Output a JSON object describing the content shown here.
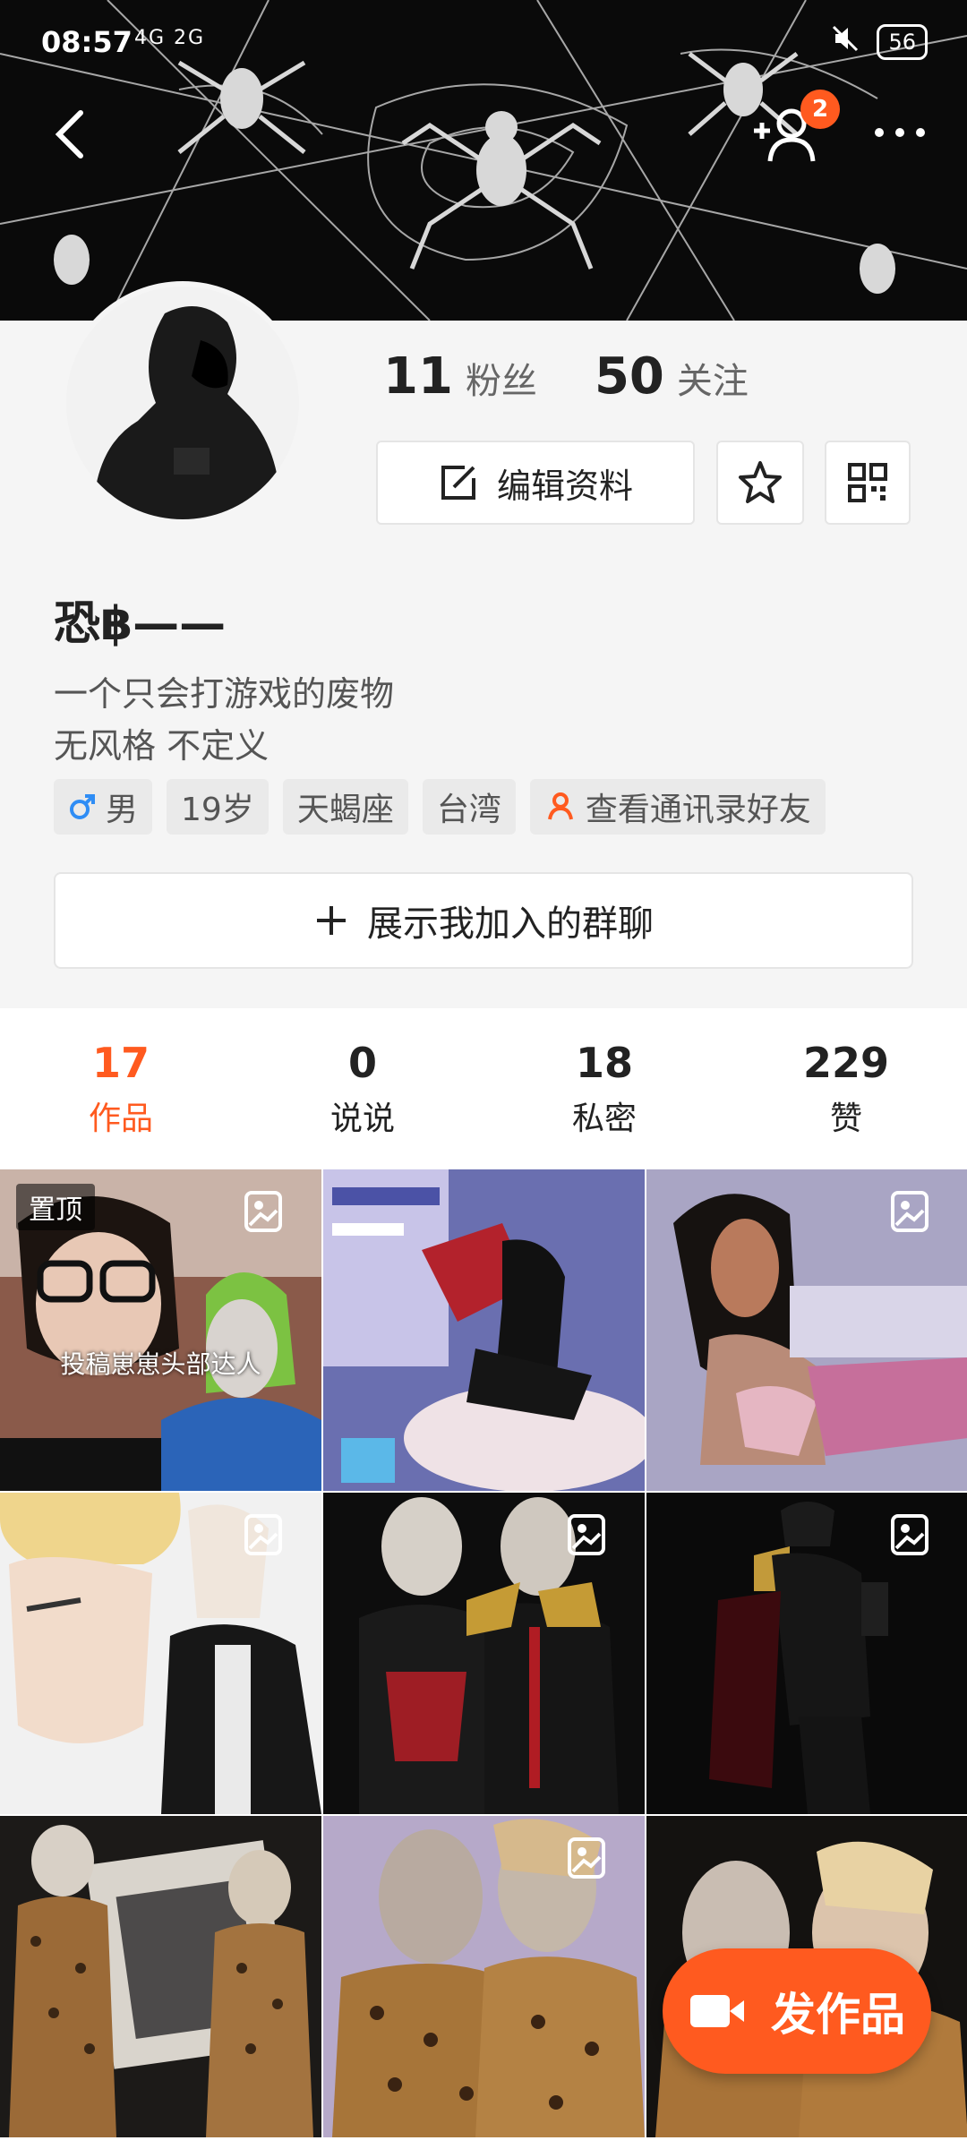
{
  "status_bar": {
    "time": "08:57",
    "network": "4G 2G",
    "battery": "56"
  },
  "header": {
    "notification_count": "2"
  },
  "profile": {
    "fans_count": "11",
    "fans_label": "粉丝",
    "following_count": "50",
    "following_label": "关注",
    "edit_label": "编辑资料",
    "username": "恐฿——",
    "bio_line1": "一个只会打游戏的废物",
    "bio_line2": "无风格 不定义",
    "tags": {
      "gender": "男",
      "age": "19岁",
      "zodiac": "天蝎座",
      "location": "台湾",
      "contacts": "查看通讯录好友"
    },
    "group_chat_label": "展示我加入的群聊"
  },
  "tabs": [
    {
      "count": "17",
      "label": "作品"
    },
    {
      "count": "0",
      "label": "说说"
    },
    {
      "count": "18",
      "label": "私密"
    },
    {
      "count": "229",
      "label": "赞"
    }
  ],
  "grid": {
    "pinned_label": "置顶",
    "overlay_text": "投稿崽崽头部达人"
  },
  "fab": {
    "label": "发作品"
  },
  "colors": {
    "accent": "#ff5a1f",
    "gender_blue": "#2f8df5"
  }
}
